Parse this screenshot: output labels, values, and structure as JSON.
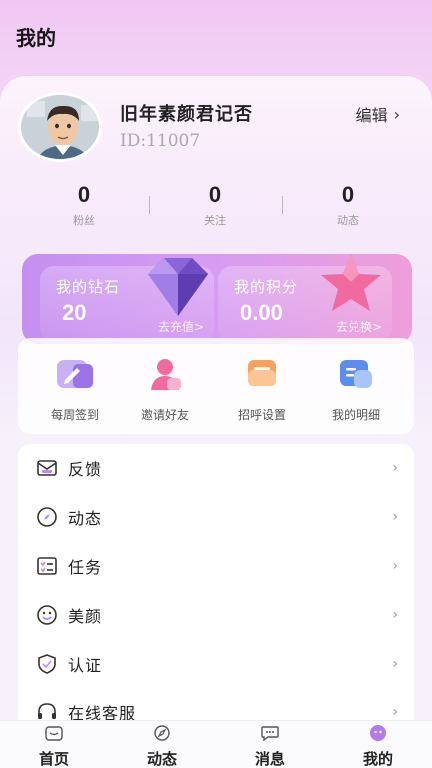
{
  "header": {
    "title": "我的"
  },
  "profile": {
    "username": "旧年素颜君记否",
    "user_id": "ID:11007",
    "edit_label": "编辑"
  },
  "stats": [
    {
      "value": "0",
      "label": "粉丝"
    },
    {
      "value": "0",
      "label": "关注"
    },
    {
      "value": "0",
      "label": "动态"
    }
  ],
  "wallet": {
    "diamonds": {
      "title": "我的钻石",
      "value": "20",
      "link": "去充值>"
    },
    "points": {
      "title": "我的积分",
      "value": "0.00",
      "link": "去兑换>"
    }
  },
  "actions": [
    {
      "label": "每周签到",
      "icon": "pencil-icon"
    },
    {
      "label": "邀请好友",
      "icon": "user-add-icon"
    },
    {
      "label": "招呼设置",
      "icon": "message-icon"
    },
    {
      "label": "我的明细",
      "icon": "list-icon"
    }
  ],
  "menu": [
    {
      "label": "反馈",
      "icon": "mail-icon"
    },
    {
      "label": "动态",
      "icon": "compass-icon"
    },
    {
      "label": "任务",
      "icon": "checklist-icon"
    },
    {
      "label": "美颜",
      "icon": "smile-icon"
    },
    {
      "label": "认证",
      "icon": "shield-check-icon"
    },
    {
      "label": "在线客服",
      "icon": "headset-icon"
    }
  ],
  "tabs": [
    {
      "label": "首页",
      "icon": "home-icon"
    },
    {
      "label": "动态",
      "icon": "feed-icon"
    },
    {
      "label": "消息",
      "icon": "chat-icon"
    },
    {
      "label": "我的",
      "icon": "profile-icon",
      "active": true
    }
  ],
  "colors": {
    "accent": "#c58ff0",
    "wallet_gradient_end": "#ef9ed8"
  }
}
